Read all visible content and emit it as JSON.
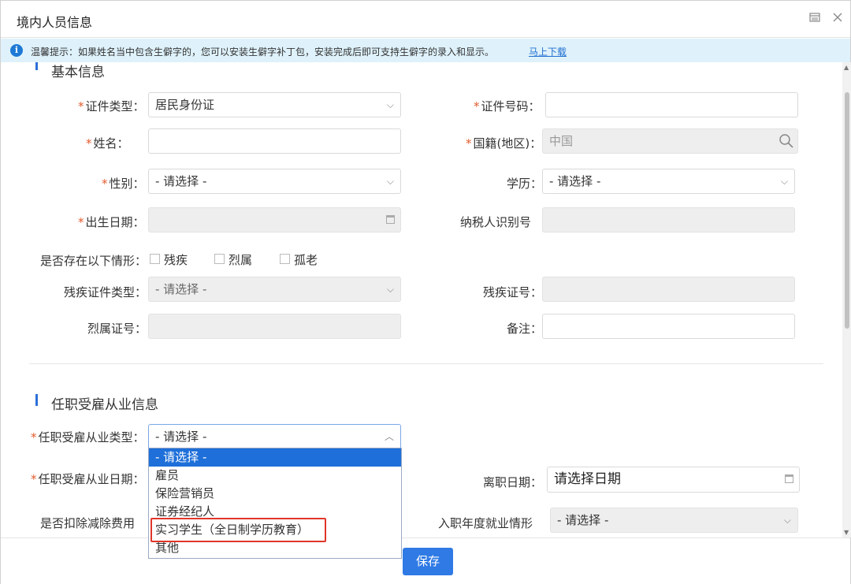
{
  "window": {
    "title": "境内人员信息"
  },
  "notice": {
    "text": "温馨提示：如果姓名当中包含生僻字的，您可以安装生僻字补丁包，安装完成后即可支持生僻字的录入和显示。",
    "link": "马上下载"
  },
  "basic": {
    "section_title": "基本信息",
    "id_type": {
      "label": "证件类型：",
      "value": "居民身份证"
    },
    "id_number": {
      "label": "证件号码：",
      "value": ""
    },
    "name": {
      "label": "姓名：",
      "value": ""
    },
    "nationality": {
      "label": "国籍(地区)：",
      "value": "中国"
    },
    "gender": {
      "label": "性别：",
      "value": "- 请选择 -"
    },
    "education": {
      "label": "学历：",
      "value": "- 请选择 -"
    },
    "birth_date": {
      "label": "出生日期：",
      "value": ""
    },
    "taxpayer_id": {
      "label": "纳税人识别号",
      "value": ""
    },
    "situation": {
      "label": "是否存在以下情形：",
      "options": [
        "残疾",
        "烈属",
        "孤老"
      ]
    },
    "disability_cert_type": {
      "label": "残疾证件类型：",
      "value": "- 请选择 -"
    },
    "disability_cert_no": {
      "label": "残疾证号：",
      "value": ""
    },
    "martyr_cert_no": {
      "label": "烈属证号：",
      "value": ""
    },
    "remarks": {
      "label": "备注：",
      "value": ""
    }
  },
  "employment": {
    "section_title": "任职受雇从业信息",
    "type": {
      "label": "任职受雇从业类型：",
      "value": "- 请选择 -"
    },
    "date": {
      "label": "任职受雇从业日期："
    },
    "leave_date": {
      "label": "离职日期：",
      "placeholder": "请选择日期"
    },
    "deduct_fee": {
      "label": "是否扣除减除费用"
    },
    "entry_year_status": {
      "label": "入职年度就业情形",
      "value": "- 请选择 -"
    },
    "type_options": [
      "- 请选择 -",
      "雇员",
      "保险营销员",
      "证券经纪人",
      "实习学生（全日制学历教育）",
      "其他"
    ],
    "selected_index": 0,
    "highlighted_option": "实习学生（全日制学历教育）"
  },
  "footer": {
    "save_label": "保存"
  },
  "colors": {
    "accent": "#2f7ae5",
    "required": "#e35b2c",
    "highlight": "#e0362a",
    "notice_bg": "#dff2fb"
  }
}
